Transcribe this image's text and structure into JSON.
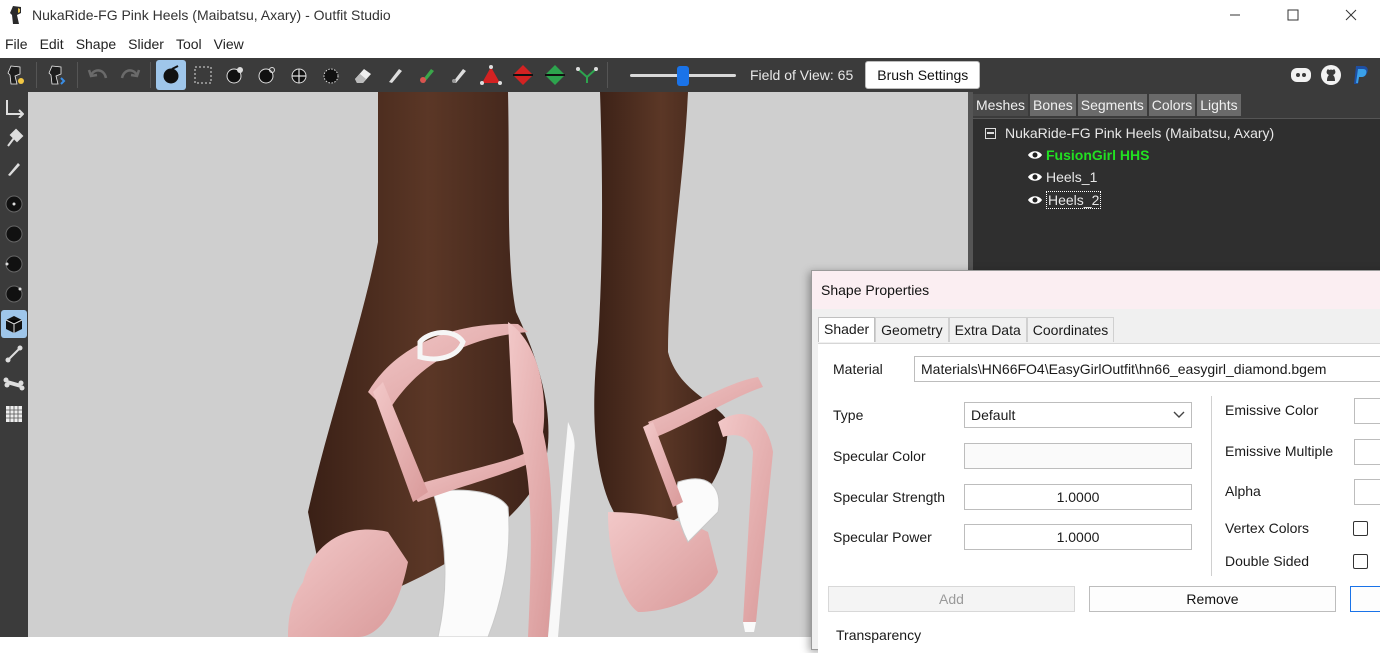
{
  "window": {
    "title": "NukaRide-FG Pink Heels (Maibatsu, Axary) - Outfit Studio",
    "controls": [
      "minimize",
      "maximize",
      "close"
    ]
  },
  "menu": [
    "File",
    "Edit",
    "Shape",
    "Slider",
    "Tool",
    "View"
  ],
  "toolbar": {
    "fov_label": "Field of View: 65",
    "fov_value": 65,
    "brush_settings": "Brush Settings"
  },
  "right_panel": {
    "tabs": [
      "Meshes",
      "Bones",
      "Segments",
      "Colors",
      "Lights"
    ],
    "tree": {
      "root": "NukaRide-FG Pink Heels (Maibatsu, Axary)",
      "items": [
        "FusionGirl HHS",
        "Heels_1",
        "Heels_2"
      ]
    }
  },
  "dialog": {
    "title": "Shape Properties",
    "tabs": [
      "Shader",
      "Geometry",
      "Extra Data",
      "Coordinates"
    ],
    "material_label": "Material",
    "material_value": "Materials\\HN66FO4\\EasyGirlOutfit\\hn66_easygirl_diamond.bgem",
    "type_label": "Type",
    "type_value": "Default",
    "specular_color_label": "Specular Color",
    "specular_strength_label": "Specular Strength",
    "specular_strength_value": "1.0000",
    "specular_power_label": "Specular Power",
    "specular_power_value": "1.0000",
    "emissive_color_label": "Emissive Color",
    "emissive_multiple_label": "Emissive Multiple",
    "alpha_label": "Alpha",
    "vertex_colors_label": "Vertex Colors",
    "double_sided_label": "Double Sided",
    "add_button": "Add",
    "remove_button": "Remove",
    "transparency_label": "Transparency"
  },
  "colors": {
    "dark_ui": "#3b3b3b",
    "highlight": "#9fc6ea",
    "green_shape": "#22e022",
    "viewport_bg": "#cfcfcf",
    "skin": "#4e2e20",
    "heel_pink": "#e8b4b4"
  }
}
